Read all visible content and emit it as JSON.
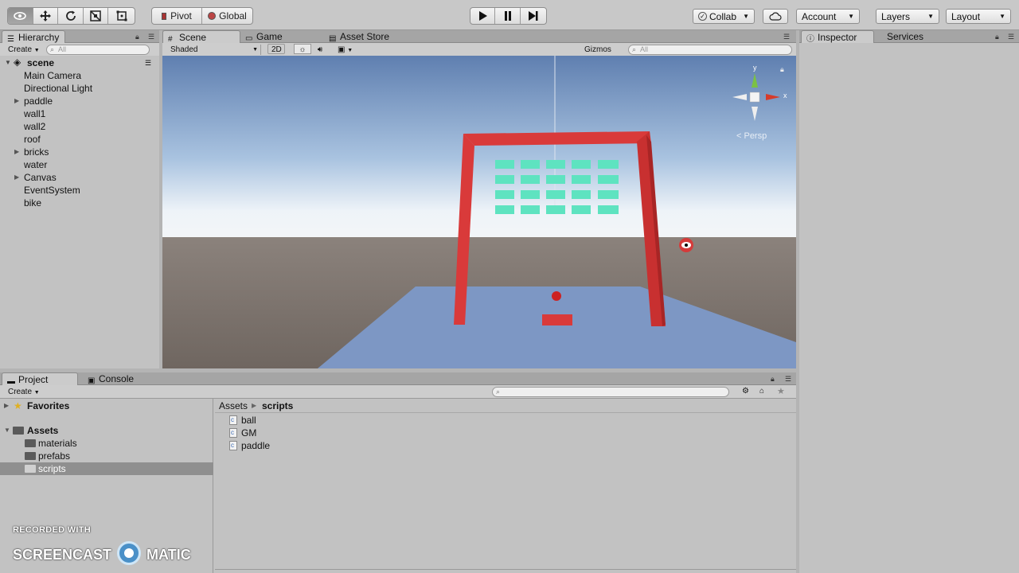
{
  "toolbar": {
    "pivot_label": "Pivot",
    "global_label": "Global",
    "collab_label": "Collab",
    "account_label": "Account",
    "layers_label": "Layers",
    "layout_label": "Layout"
  },
  "hierarchy": {
    "tab_label": "Hierarchy",
    "create_label": "Create",
    "search_placeholder": "All",
    "scene_name": "scene",
    "items": [
      {
        "label": "Main Camera",
        "expandable": false
      },
      {
        "label": "Directional Light",
        "expandable": false
      },
      {
        "label": "paddle",
        "expandable": true
      },
      {
        "label": "wall1",
        "expandable": false
      },
      {
        "label": "wall2",
        "expandable": false
      },
      {
        "label": "roof",
        "expandable": false
      },
      {
        "label": "bricks",
        "expandable": true
      },
      {
        "label": "water",
        "expandable": false
      },
      {
        "label": "Canvas",
        "expandable": true
      },
      {
        "label": "EventSystem",
        "expandable": false
      },
      {
        "label": "bike",
        "expandable": false
      }
    ]
  },
  "scene_tabs": {
    "scene": "Scene",
    "game": "Game",
    "asset_store": "Asset Store"
  },
  "scene_toolbar": {
    "shading": "Shaded",
    "mode_2d": "2D",
    "gizmos": "Gizmos",
    "search_placeholder": "All"
  },
  "scene_view": {
    "projection": "< Persp",
    "axis_x": "x",
    "axis_y": "y",
    "sky_top": "#5f7fb0",
    "horizon": "#eef3f8",
    "ground": "#7a716c",
    "floor_color": "#7d97c4",
    "frame_color": "#d93a3a",
    "brick_color": "#5ee3c0"
  },
  "inspector": {
    "tab_label": "Inspector",
    "services_label": "Services"
  },
  "project": {
    "tab_label": "Project",
    "console_label": "Console",
    "create_label": "Create",
    "favorites_label": "Favorites",
    "assets_label": "Assets",
    "folders": [
      "materials",
      "prefabs",
      "scripts"
    ],
    "selected_folder": "scripts",
    "breadcrumb_root": "Assets",
    "breadcrumb_current": "scripts",
    "files": [
      "ball",
      "GM",
      "paddle"
    ]
  },
  "watermark": {
    "line1": "RECORDED WITH",
    "line2_left": "SCREENCAST",
    "line2_right": "MATIC"
  }
}
